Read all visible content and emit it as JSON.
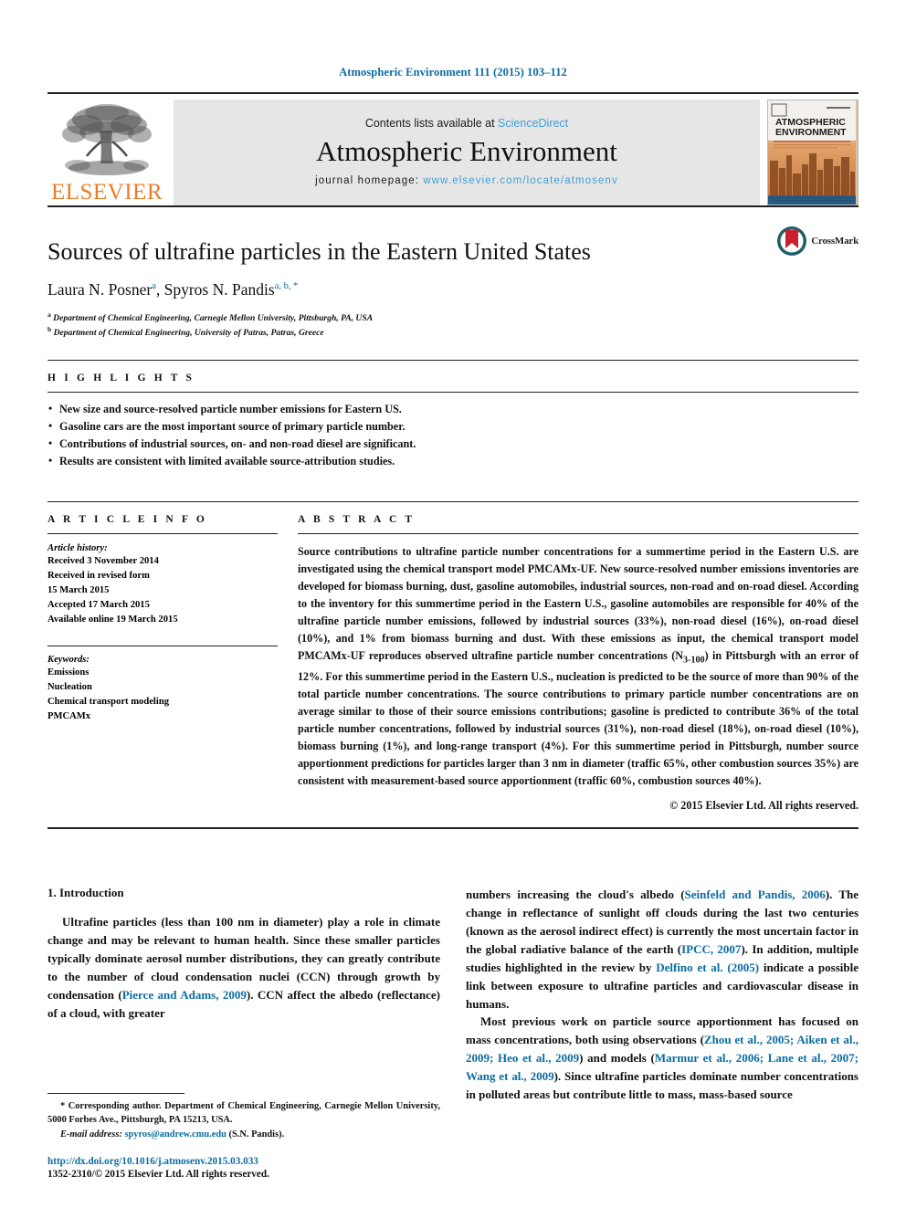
{
  "running_head": "Atmospheric Environment 111 (2015) 103–112",
  "banner": {
    "publisher_name": "ELSEVIER",
    "publisher_logo_icon": "elsevier-tree-logo",
    "contents_prefix": "Contents lists available at ",
    "contents_link": "ScienceDirect",
    "journal_name": "Atmospheric Environment",
    "homepage_prefix": "journal homepage: ",
    "homepage_url": "www.elsevier.com/locate/atmosenv",
    "cover_title_line1": "ATMOSPHERIC",
    "cover_title_line2": "ENVIRONMENT"
  },
  "article": {
    "title": "Sources of ultrafine particles in the Eastern United States",
    "authors_plain": "Laura N. Posner a, Spyros N. Pandis a, b, *",
    "author1_name": "Laura N. Posner",
    "author1_sup": "a",
    "author2_name": "Spyros N. Pandis",
    "author2_sup": "a, b, *",
    "affiliation_a_sup": "a",
    "affiliation_a": "Department of Chemical Engineering, Carnegie Mellon University, Pittsburgh, PA, USA",
    "affiliation_b_sup": "b",
    "affiliation_b": "Department of Chemical Engineering, University of Patras, Patras, Greece",
    "crossmark_label": "CrossMark"
  },
  "highlights": {
    "heading": "H I G H L I G H T S",
    "items": [
      "New size and source-resolved particle number emissions for Eastern US.",
      "Gasoline cars are the most important source of primary particle number.",
      "Contributions of industrial sources, on- and non-road diesel are significant.",
      "Results are consistent with limited available source-attribution studies."
    ]
  },
  "article_info": {
    "heading": "A R T I C L E   I N F O",
    "history_label": "Article history:",
    "history_lines": [
      "Received 3 November 2014",
      "Received in revised form",
      "15 March 2015",
      "Accepted 17 March 2015",
      "Available online 19 March 2015"
    ],
    "keywords_label": "Keywords:",
    "keywords": [
      "Emissions",
      "Nucleation",
      "Chemical transport modeling",
      "PMCAMx"
    ]
  },
  "abstract": {
    "heading": "A B S T R A C T",
    "part1": "Source contributions to ultrafine particle number concentrations for a summertime period in the Eastern U.S. are investigated using the chemical transport model PMCAMx-UF. New source-resolved number emissions inventories are developed for biomass burning, dust, gasoline automobiles, industrial sources, non-road and on-road diesel. According to the inventory for this summertime period in the Eastern U.S., gasoline automobiles are responsible for 40% of the ultrafine particle number emissions, followed by industrial sources (33%), non-road diesel (16%), on-road diesel (10%), and 1% from biomass burning and dust. With these emissions as input, the chemical transport model PMCAMx-UF reproduces observed ultrafine particle number concentrations (N",
    "subscript": "3-100",
    "part2": ") in Pittsburgh with an error of 12%. For this summertime period in the Eastern U.S., nucleation is predicted to be the source of more than 90% of the total particle number concentrations. The source contributions to primary particle number concentrations are on average similar to those of their source emissions contributions; gasoline is predicted to contribute 36% of the total particle number concentrations, followed by industrial sources (31%), non-road diesel (18%), on-road diesel (10%), biomass burning (1%), and long-range transport (4%). For this summertime period in Pittsburgh, number source apportionment predictions for particles larger than 3 nm in diameter (traffic 65%, other combustion sources 35%) are consistent with measurement-based source apportionment (traffic 60%, combustion sources 40%).",
    "copyright": "© 2015 Elsevier Ltd. All rights reserved."
  },
  "introduction": {
    "section_number_title": "1. Introduction",
    "left_p1_a": "Ultrafine particles (less than 100 nm in diameter) play a role in climate change and may be relevant to human health. Since these smaller particles typically dominate aerosol number distributions, they can greatly contribute to the number of cloud condensation nuclei (CCN) through growth by condensation (",
    "left_p1_cite1": "Pierce and Adams, 2009",
    "left_p1_b": "). CCN affect the albedo (reflectance) of a cloud, with greater",
    "right_p1_a": "numbers increasing the cloud's albedo (",
    "right_p1_cite1": "Seinfeld and Pandis, 2006",
    "right_p1_b": "). The change in reflectance of sunlight off clouds during the last two centuries (known as the aerosol indirect effect) is currently the most uncertain factor in the global radiative balance of the earth (",
    "right_p1_cite2": "IPCC, 2007",
    "right_p1_c": "). In addition, multiple studies highlighted in the review by ",
    "right_p1_cite3": "Delfino et al. (2005)",
    "right_p1_d": " indicate a possible link between exposure to ultrafine particles and cardiovascular disease in humans.",
    "right_p2_a": "Most previous work on particle source apportionment has focused on mass concentrations, both using observations (",
    "right_p2_cite1": "Zhou et al., 2005; Aiken et al., 2009; Heo et al., 2009",
    "right_p2_b": ") and models (",
    "right_p2_cite2": "Marmur et al., 2006; Lane et al., 2007; Wang et al., 2009",
    "right_p2_c": "). Since ultrafine particles dominate number concentrations in polluted areas but contribute little to mass, mass-based source"
  },
  "footnote": {
    "corresponding_marker": "*",
    "corresponding_text": "Corresponding author. Department of Chemical Engineering, Carnegie Mellon University, 5000 Forbes Ave., Pittsburgh, PA 15213, USA.",
    "email_label": "E-mail address:",
    "email": "spyros@andrew.cmu.edu",
    "email_owner": "(S.N. Pandis).",
    "doi": "http://dx.doi.org/10.1016/j.atmosenv.2015.03.033",
    "issn": "1352-2310/© 2015 Elsevier Ltd. All rights reserved."
  },
  "colors": {
    "link_blue": "#0b6ca0",
    "sciencedirect_blue": "#3ea0d4",
    "elsevier_orange": "#ef7b23",
    "banner_grey": "#e6e6e6",
    "rule_black": "#231f20"
  }
}
